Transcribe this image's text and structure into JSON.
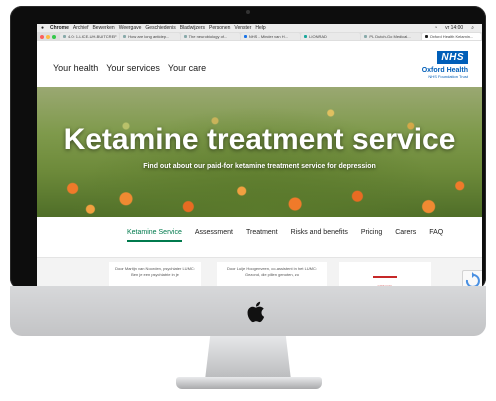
{
  "menubar": {
    "app": "Chrome",
    "items": [
      "Archief",
      "Bewerken",
      "Weergave",
      "Geschiedenis",
      "Bladwijzers",
      "Personen",
      "Venster",
      "Help"
    ],
    "clock": "vr 14:00"
  },
  "browser": {
    "tabs": [
      {
        "label": "4.0: 1-LICE-UH-BUITCREF"
      },
      {
        "label": "How are long antidep..."
      },
      {
        "label": "The neurobiology of..."
      },
      {
        "label": "NHS - Minder van H..."
      },
      {
        "label": "LIONRAD"
      },
      {
        "label": "PL Dutch-Go Medical..."
      },
      {
        "label": "Oxford Health Kelamin..."
      }
    ],
    "active_tab": 6
  },
  "site": {
    "nav": [
      "Your health",
      "Your services",
      "Your care"
    ],
    "logo": {
      "nhs": "NHS",
      "org": "Oxford Health",
      "trust": "NHS Foundation Trust"
    }
  },
  "hero": {
    "title": "Ketamine treatment service",
    "subtitle": "Find out about our paid-for ketamine treatment service for depression"
  },
  "subnav": {
    "items": [
      "Ketamine Service",
      "Assessment",
      "Treatment",
      "Risks and benefits",
      "Pricing",
      "Carers",
      "FAQ"
    ],
    "active": 0
  },
  "cards": [
    {
      "text": "Door Martijn van Noorden, psychiater LUMC: Ben je een psychiatrie in je"
    },
    {
      "text": "Door Luije Hoogenveen, co-assistent in het LUMC: Gezond, die pillen genoten, zo"
    },
    {
      "text": "ARTIKEL"
    }
  ],
  "colors": {
    "nhs_blue": "#005eb8",
    "subnav_active": "#007a4d"
  },
  "icons": [
    "apple-logo-icon",
    "recaptcha-icon"
  ]
}
